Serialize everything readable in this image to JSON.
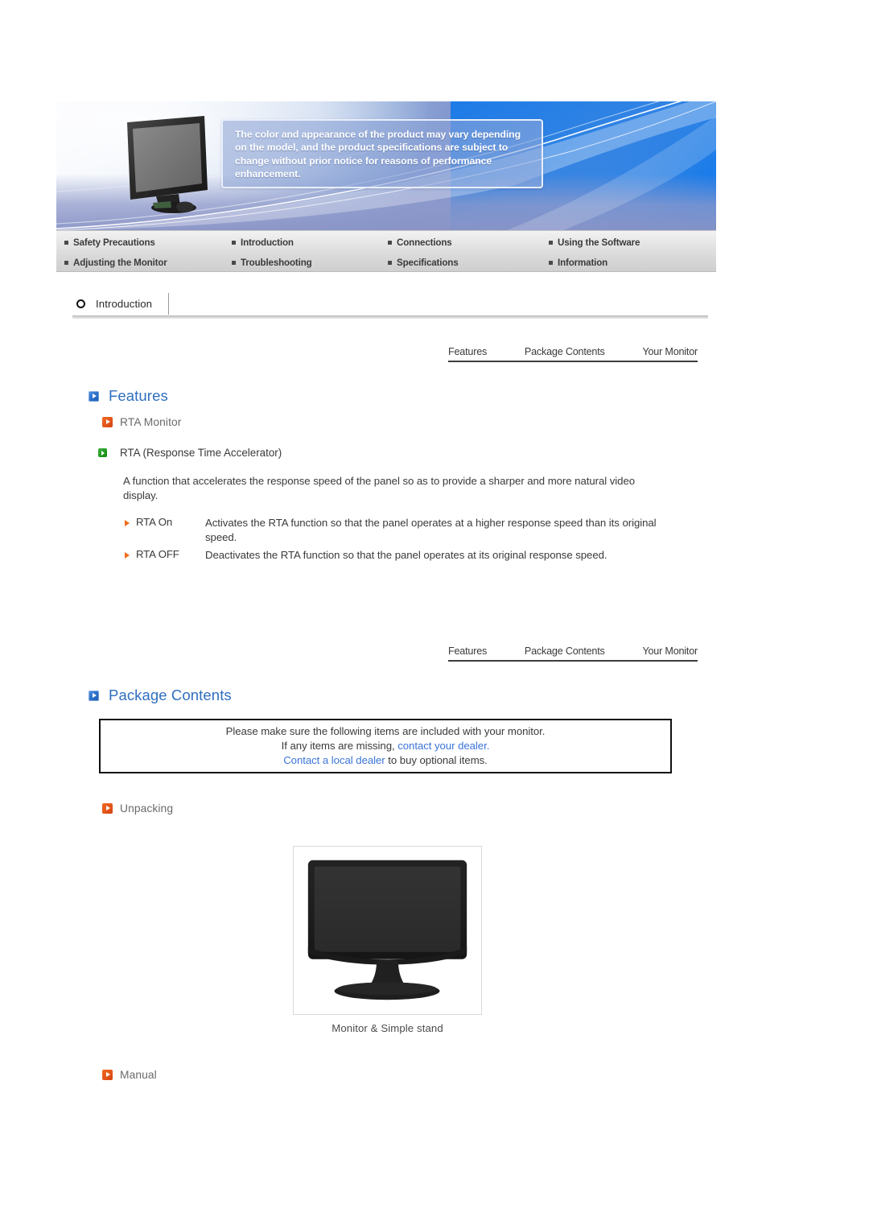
{
  "banner": {
    "callout_text": "The color and appearance of the product may vary depending on the model, and the product specifications are subject to change without prior notice for reasons of performance enhancement.",
    "monitor_icon": "lcd-monitor-hero-image"
  },
  "nav": {
    "items": [
      "Safety Precautions",
      "Introduction",
      "Connections",
      "Using the Software",
      "Adjusting the Monitor",
      "Troubleshooting",
      "Specifications",
      "Information"
    ]
  },
  "section_header": {
    "icon": "ring-icon",
    "label": "Introduction"
  },
  "subtabs": {
    "items": [
      "Features",
      "Package Contents",
      "Your Monitor"
    ]
  },
  "features": {
    "heading": "Features",
    "subheading": "RTA Monitor",
    "green_item": "RTA (Response Time Accelerator)",
    "paragraph": "A function that accelerates the response speed of the panel so as to provide a sharper and more natural video display.",
    "bullets": [
      {
        "term": "RTA On",
        "desc": "Activates the RTA function so that the panel operates at a higher response speed than its original speed."
      },
      {
        "term": "RTA OFF",
        "desc": "Deactivates the RTA function so that the panel operates at its original response speed."
      }
    ]
  },
  "package_contents": {
    "heading": "Package Contents",
    "notice": {
      "line1": "Please make sure the following items are included with your monitor.",
      "line2_prefix": "If any items are missing, ",
      "line2_link": "contact your dealer",
      "line2_suffix": ".",
      "line3_link": "Contact a local dealer",
      "line3_suffix": " to buy optional items."
    },
    "unpacking_heading": "Unpacking",
    "product_caption": "Monitor & Simple stand",
    "manual_heading": "Manual"
  },
  "colors": {
    "heading_blue": "#2f6fbf",
    "link_blue": "#3a74d8",
    "accent_orange": "#ef6c1f",
    "accent_green": "#209a20"
  }
}
